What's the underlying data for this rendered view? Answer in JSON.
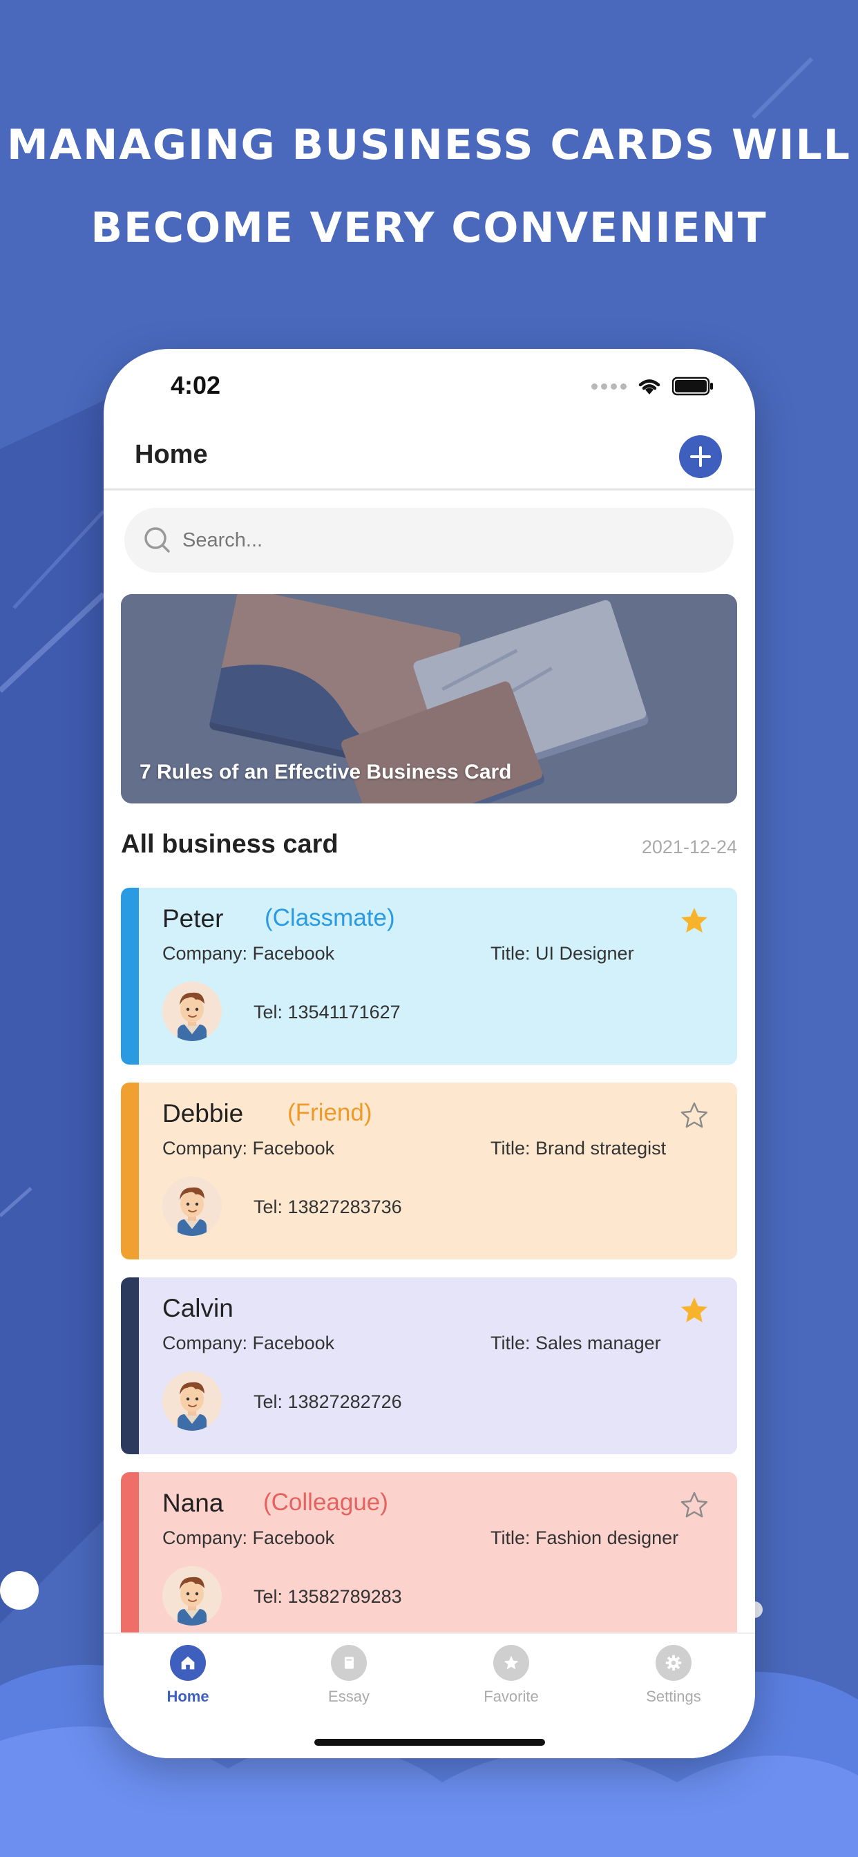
{
  "headline": {
    "line1": "MANAGING BUSINESS CARDS WILL",
    "line2": "BECOME VERY CONVENIENT"
  },
  "status": {
    "time": "4:02"
  },
  "nav": {
    "title": "Home"
  },
  "search": {
    "placeholder": "Search..."
  },
  "banner": {
    "title": "7 Rules of an Effective Business Card"
  },
  "section": {
    "title": "All business card",
    "date": "2021-12-24"
  },
  "cards": [
    {
      "name": "Peter",
      "tag": "(Classmate)",
      "company": "Company: Facebook",
      "title": "Title: UI Designer",
      "tel": "Tel: 13541171627",
      "favorite": true,
      "bg": "#d3f1fb",
      "stripe": "#2a9be3",
      "tag_color": "#2a9be3"
    },
    {
      "name": "Debbie",
      "tag": "(Friend)",
      "company": "Company: Facebook",
      "title": "Title: Brand strategist",
      "tel": "Tel: 13827283736",
      "favorite": false,
      "bg": "#fde8cf",
      "stripe": "#f0a030",
      "tag_color": "#ee9a2a"
    },
    {
      "name": "Calvin",
      "tag": "",
      "company": "Company: Facebook",
      "title": "Title: Sales manager",
      "tel": "Tel: 13827282726",
      "favorite": true,
      "bg": "#e6e4f8",
      "stripe": "#2c3a5e",
      "tag_color": "#2c3a5e"
    },
    {
      "name": "Nana",
      "tag": "(Colleague)",
      "company": "Company: Facebook",
      "title": "Title: Fashion designer",
      "tel": "Tel: 13582789283",
      "favorite": false,
      "bg": "#fcd2cc",
      "stripe": "#ef6e68",
      "tag_color": "#e6625e"
    }
  ],
  "tabs": [
    {
      "label": "Home",
      "icon": "home-icon",
      "active": true
    },
    {
      "label": "Essay",
      "icon": "book-icon",
      "active": false
    },
    {
      "label": "Favorite",
      "icon": "star-icon",
      "active": false
    },
    {
      "label": "Settings",
      "icon": "gear-icon",
      "active": false
    }
  ],
  "colors": {
    "background": "#4a69bd",
    "accent": "#3f5fbf",
    "star": "#f7b32b"
  }
}
